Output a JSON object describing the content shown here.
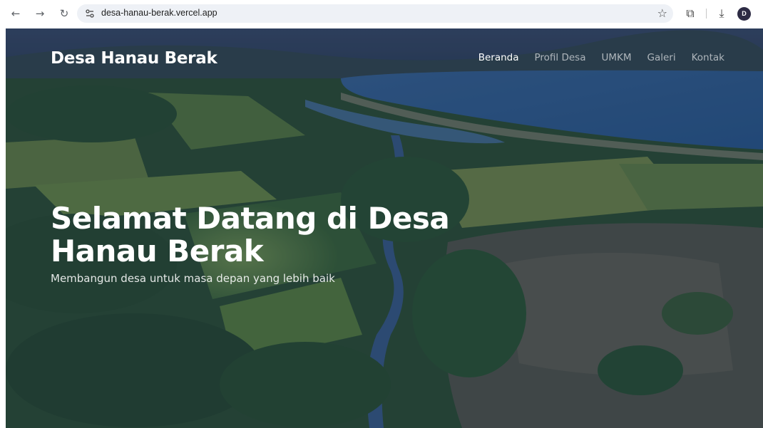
{
  "browser": {
    "url": "desa-hanau-berak.vercel.app",
    "profile_initial": "D"
  },
  "site": {
    "brand": "Desa Hanau Berak",
    "nav": [
      {
        "label": "Beranda",
        "active": true
      },
      {
        "label": "Profil Desa",
        "active": false
      },
      {
        "label": "UMKM",
        "active": false
      },
      {
        "label": "Galeri",
        "active": false
      },
      {
        "label": "Kontak",
        "active": false
      }
    ]
  },
  "hero": {
    "title": "Selamat Datang di Desa Hanau Berak",
    "subtitle": "Membangun desa untuk masa depan yang lebih baik"
  },
  "colors": {
    "overlay": "#14284b",
    "sea": "#3f6d9e",
    "field": "#6f8f3a",
    "forest": "#2f5a2a"
  }
}
